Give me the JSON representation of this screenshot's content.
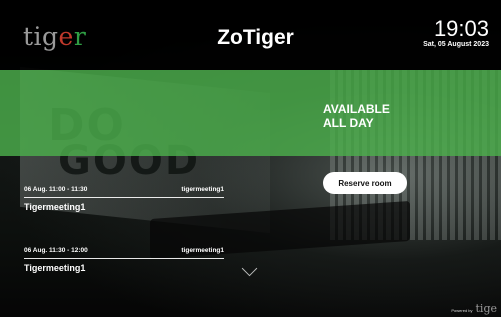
{
  "header": {
    "logo": {
      "t1": "tig",
      "t2": "e",
      "t3": "r"
    },
    "title": "ZoTiger",
    "time": "19:03",
    "date": "Sat, 05 August 2023"
  },
  "status": {
    "line1": "AVAILABLE",
    "line2": "ALL DAY"
  },
  "reserve_label": "Reserve room",
  "meetings": [
    {
      "time": "06  Aug. 11:00 - 11:30",
      "organizer": "tigermeeting1",
      "title": "Tigermeeting1"
    },
    {
      "time": "06  Aug. 11:30 - 12:00",
      "organizer": "tigermeeting1",
      "title": "Tigermeeting1"
    }
  ],
  "background_words": [
    "DO",
    "GOOD"
  ],
  "footer": {
    "powered": "Powered by",
    "brand": "tige"
  },
  "colors": {
    "available_band": "#4cae4c",
    "logo_e": "#c0392b",
    "logo_r": "#2f9e44"
  },
  "icons": {
    "more": "chevron-down-icon"
  }
}
